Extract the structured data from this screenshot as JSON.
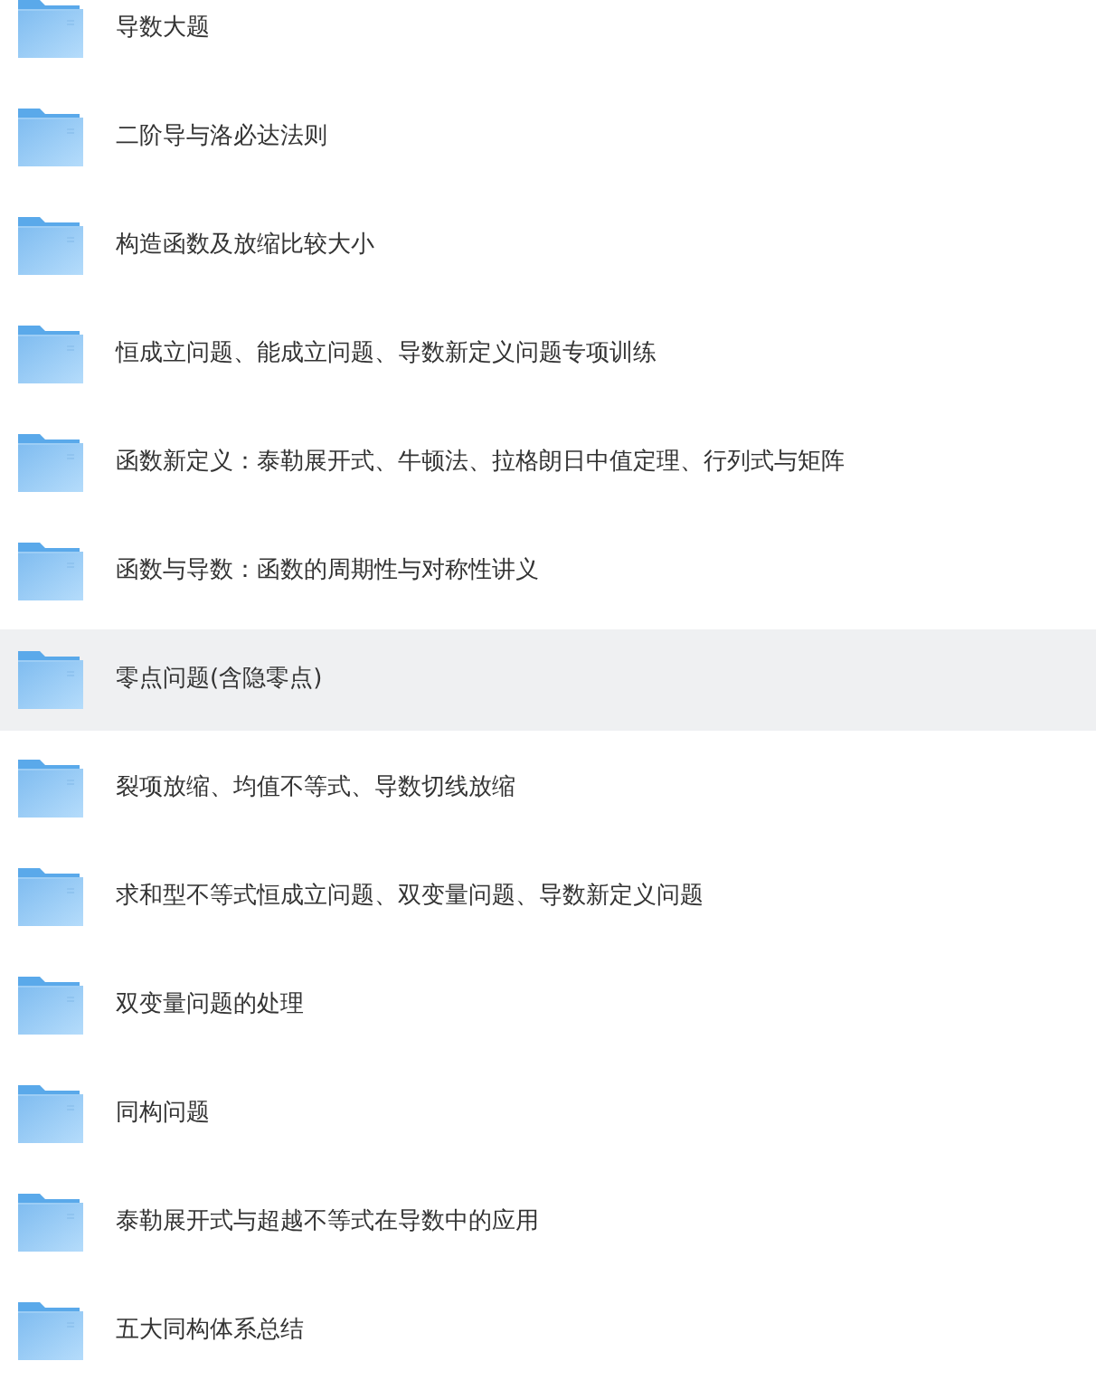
{
  "folders": [
    {
      "name": "导数大题",
      "selected": false
    },
    {
      "name": "二阶导与洛必达法则",
      "selected": false
    },
    {
      "name": "构造函数及放缩比较大小",
      "selected": false
    },
    {
      "name": "恒成立问题、能成立问题、导数新定义问题专项训练",
      "selected": false
    },
    {
      "name": "函数新定义：泰勒展开式、牛顿法、拉格朗日中值定理、行列式与矩阵",
      "selected": false
    },
    {
      "name": "函数与导数：函数的周期性与对称性讲义",
      "selected": false
    },
    {
      "name": "零点问题(含隐零点)",
      "selected": true
    },
    {
      "name": "裂项放缩、均值不等式、导数切线放缩",
      "selected": false
    },
    {
      "name": "求和型不等式恒成立问题、双变量问题、导数新定义问题",
      "selected": false
    },
    {
      "name": "双变量问题的处理",
      "selected": false
    },
    {
      "name": "同构问题",
      "selected": false
    },
    {
      "name": "泰勒展开式与超越不等式在导数中的应用",
      "selected": false
    },
    {
      "name": "五大同构体系总结",
      "selected": false
    }
  ]
}
